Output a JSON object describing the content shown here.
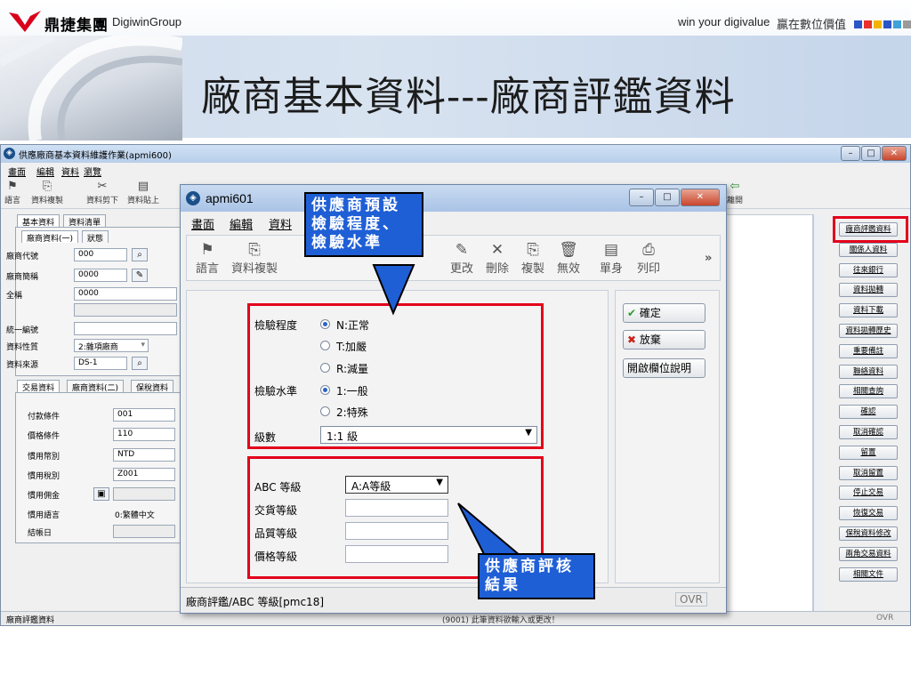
{
  "slide": {
    "logo_cn": "鼎捷集團",
    "logo_en": "DigiwinGroup",
    "slogan_en": "win your digivalue",
    "slogan_cn": "贏在數位價值",
    "title": "廠商基本資料---廠商評鑑資料",
    "square_colors": [
      "#2b56c6",
      "#e8322a",
      "#f3b400",
      "#2b56c6",
      "#3fa2d8",
      "#9a9a9a"
    ]
  },
  "main_window": {
    "title": "供應廠商基本資料維護作業(apmi600)",
    "menu": [
      "畫面",
      "編輯",
      "資料",
      "瀏覽"
    ],
    "toolbar": [
      {
        "icon": "flag-icon",
        "label": "語言"
      },
      {
        "icon": "copy-icon",
        "label": "資料複製"
      },
      {
        "icon": "cut-icon",
        "label": "資料剪下"
      },
      {
        "icon": "paste-icon",
        "label": "資料貼上"
      },
      {
        "icon": "exit-icon",
        "label": "離開"
      }
    ],
    "tabs_top": [
      "基本資料",
      "資料清單"
    ],
    "subtabs": [
      "廠商資料(一)",
      "狀態"
    ],
    "fields": [
      {
        "label": "廠商代號",
        "value": "000"
      },
      {
        "label": "廠商簡稱",
        "value": "0000"
      },
      {
        "label": "全稱",
        "value": "0000"
      },
      {
        "label": "統一編號",
        "value": ""
      },
      {
        "label": "資料性質",
        "value": "2:雜項廠商"
      },
      {
        "label": "資料來源",
        "value": "DS-1"
      }
    ],
    "tabs_lower": [
      "交易資料",
      "廠商資料(二)",
      "保稅資料"
    ],
    "trade_fields": [
      {
        "label": "付款條件",
        "value": "001"
      },
      {
        "label": "價格條件",
        "value": "110"
      },
      {
        "label": "慣用幣別",
        "value": "NTD"
      },
      {
        "label": "慣用稅別",
        "value": "Z001"
      },
      {
        "label": "慣用佣金",
        "value": ""
      },
      {
        "label": "慣用語言",
        "value": "0:繁體中文"
      },
      {
        "label": "結帳日",
        "value": ""
      }
    ],
    "right_buttons": [
      "廠商評鑑資料",
      "關係人資料",
      "往來銀行",
      "資料拋轉",
      "資料下載",
      "資料拋轉歷史",
      "重要備註",
      "聯絡資料",
      "相關查詢",
      "確認",
      "取消確認",
      "留置",
      "取消留置",
      "停止交易",
      "恢復交易",
      "保稅資料修改",
      "兩角交易資料",
      "相關文件"
    ],
    "status_left": "廠商評鑑資料",
    "status_mid": "(9001) 此筆資料欲輸入或更改！",
    "status_right": "OVR"
  },
  "dialog": {
    "title": "apmi601",
    "menu": [
      "畫面",
      "編輯",
      "資料"
    ],
    "toolbar": [
      {
        "icon": "flag-icon",
        "label": "語言"
      },
      {
        "icon": "copy-icon",
        "label": "資料複製"
      },
      {
        "icon": "edit-icon",
        "label": "更改"
      },
      {
        "icon": "delete-icon",
        "label": "刪除"
      },
      {
        "icon": "duplicate-icon",
        "label": "複製"
      },
      {
        "icon": "trash-icon",
        "label": "無效"
      },
      {
        "icon": "document-icon",
        "label": "單身"
      },
      {
        "icon": "print-icon",
        "label": "列印"
      }
    ],
    "more": "»",
    "inspect_level_label": "檢驗程度",
    "inspect_levels": [
      "N:正常",
      "T:加嚴",
      "R:減量"
    ],
    "inspect_std_label": "檢驗水準",
    "inspect_stds": [
      "1:一般",
      "2:特殊"
    ],
    "grade_label": "級數",
    "grade_value": "1:1 級",
    "abc_label": "ABC 等級",
    "abc_value": "A:A等級",
    "delivery_label": "交貨等級",
    "quality_label": "品質等級",
    "price_label": "價格等級",
    "confirm": "確定",
    "cancel": "放棄",
    "open_help": "開啟欄位說明",
    "status_text": "廠商評鑑/ABC 等級[pmc18]",
    "status_right": "OVR"
  },
  "callouts": {
    "top": "供應商預設檢驗程度、檢驗水準",
    "bottom": "供應商評核結果"
  }
}
